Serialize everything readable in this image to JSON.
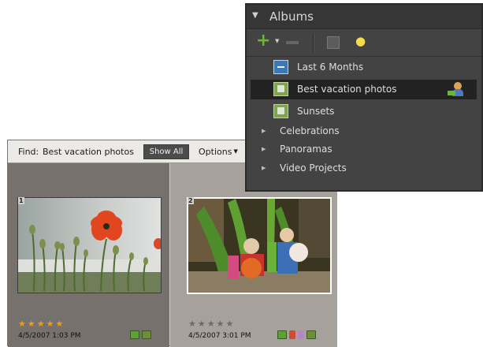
{
  "find_bar": {
    "find_label": "Find:",
    "find_value": "Best vacation photos",
    "show_all_label": "Show All",
    "options_label": "Options"
  },
  "photos": [
    {
      "number": "1",
      "rating": 5,
      "max_rating": 5,
      "date": "4/5/2007 1:03 PM",
      "tags": [
        "green",
        "album"
      ]
    },
    {
      "number": "2",
      "rating": 0,
      "max_rating": 5,
      "date": "4/5/2007 3:01 PM",
      "tags": [
        "green",
        "red",
        "purple",
        "album"
      ]
    }
  ],
  "albums_panel": {
    "title": "Albums",
    "albums": [
      {
        "label": "Last 6 Months",
        "icon": "smart-album-icon",
        "selected": false
      },
      {
        "label": "Best vacation photos",
        "icon": "album-icon",
        "selected": true,
        "shared": true
      },
      {
        "label": "Sunsets",
        "icon": "album-icon",
        "selected": false
      }
    ],
    "groups": [
      {
        "label": "Celebrations"
      },
      {
        "label": "Panoramas"
      },
      {
        "label": "Video Projects"
      }
    ]
  },
  "colors": {
    "star_filled": "#f39a12",
    "star_empty": "#6a6a6a",
    "selected_row": "#222222",
    "panel_bg": "#434343",
    "add_green": "#6bb43a"
  }
}
